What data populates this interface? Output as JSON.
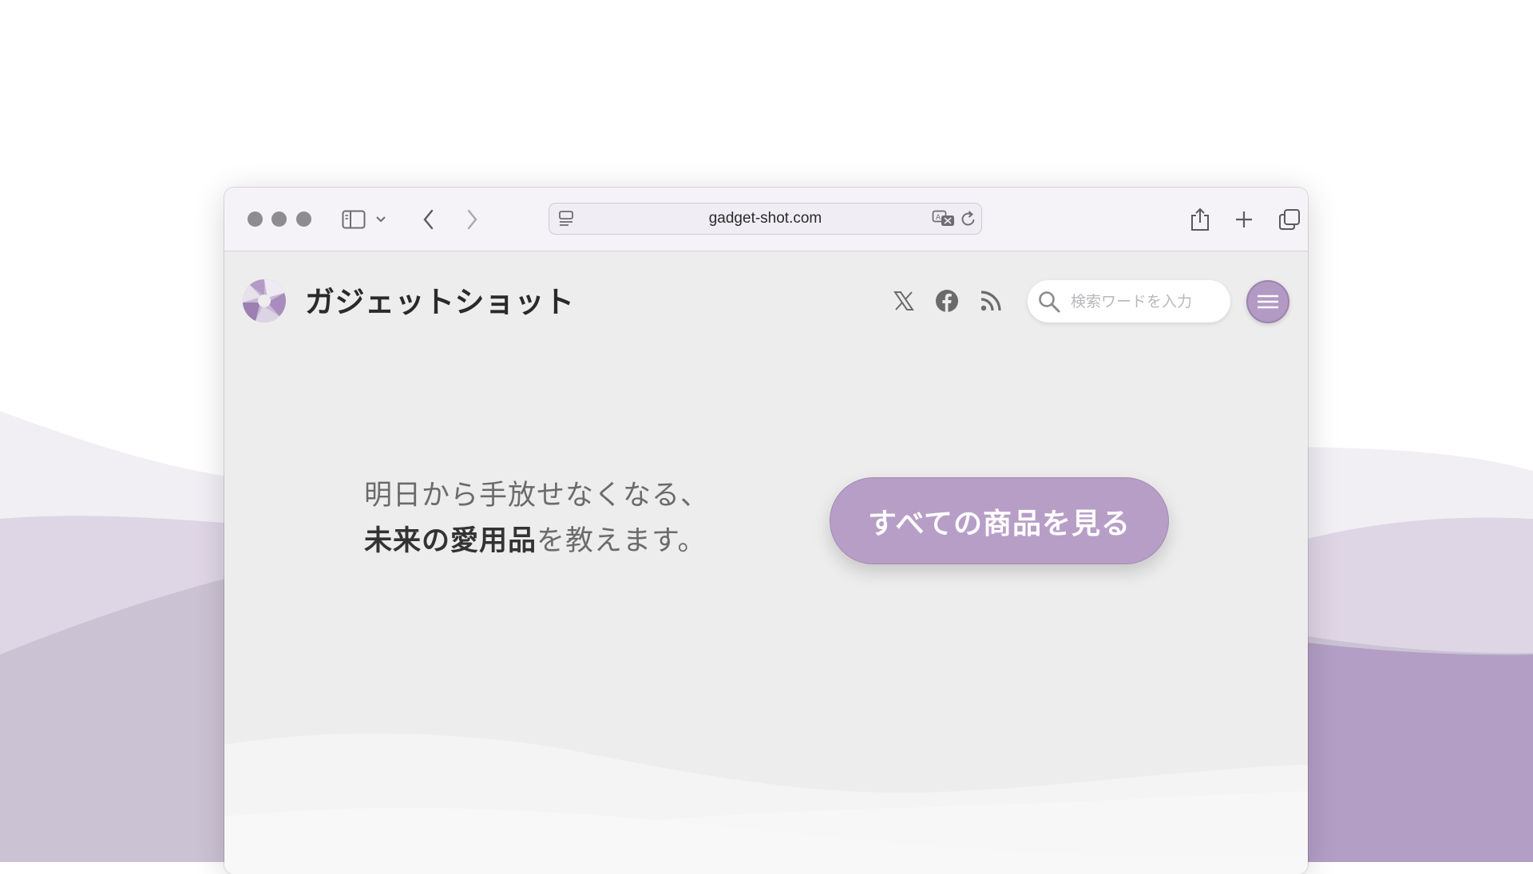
{
  "browser": {
    "url": "gadget-shot.com",
    "icons": [
      "sidebar-icon",
      "chevron-down-icon",
      "back-icon",
      "forward-icon",
      "page-settings-icon",
      "translate-icon",
      "reload-icon",
      "share-icon",
      "new-tab-icon",
      "tab-overview-icon"
    ]
  },
  "site": {
    "title": "ガジェットショット",
    "social_icons": [
      "x-icon",
      "facebook-icon",
      "rss-icon"
    ],
    "search": {
      "placeholder": "検索ワードを入力",
      "value": ""
    }
  },
  "hero": {
    "line1": "明日から手放せなくなる、",
    "line2_bold": "未来の愛用品",
    "line2_rest": "を教えます。",
    "cta_label": "すべての商品を見る"
  },
  "colors": {
    "accent": "#b79ec7",
    "accent_dark": "#9d83b0",
    "page_bg": "#ededed",
    "toolbar_bg": "#f5f3f8"
  }
}
